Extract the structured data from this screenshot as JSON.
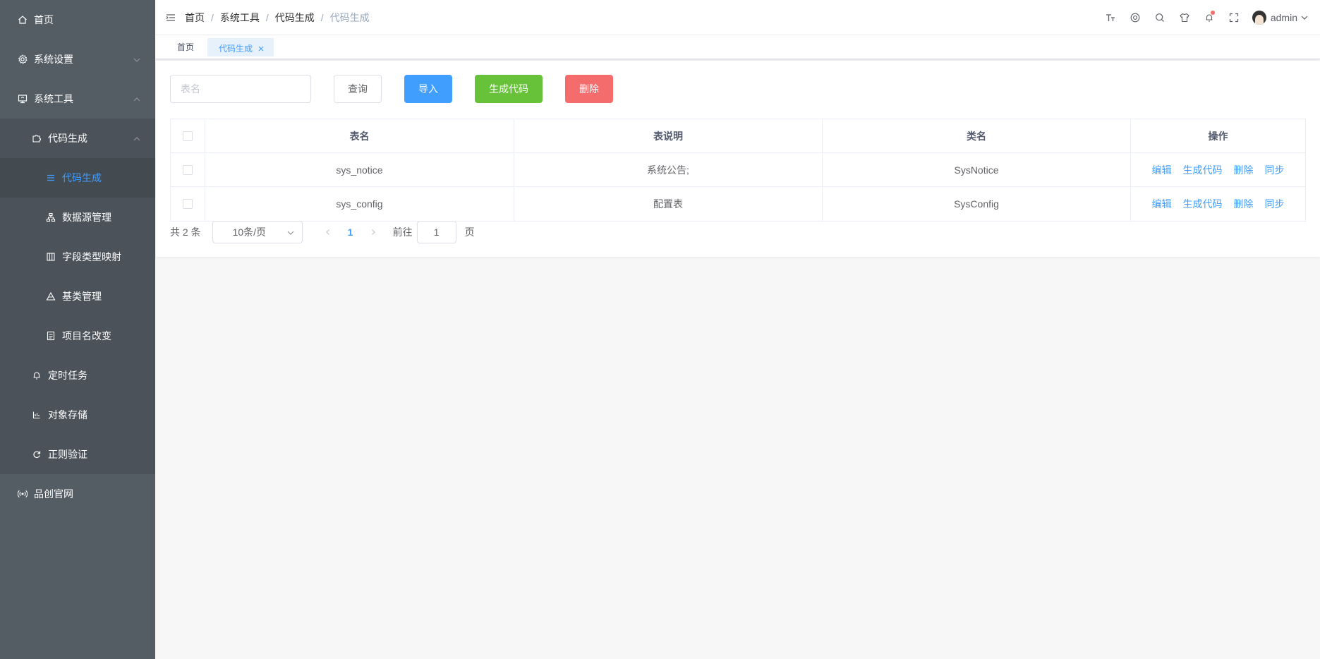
{
  "sidebar": {
    "items": [
      {
        "label": "首页",
        "icon": "home-icon"
      },
      {
        "label": "系统设置",
        "icon": "gear-icon"
      },
      {
        "label": "系统工具",
        "icon": "monitor-icon"
      },
      {
        "label": "代码生成",
        "icon": "puzzle-icon"
      },
      {
        "label": "代码生成",
        "icon": "list-icon"
      },
      {
        "label": "数据源管理",
        "icon": "sitemap-icon"
      },
      {
        "label": "字段类型映射",
        "icon": "table-icon"
      },
      {
        "label": "基类管理",
        "icon": "triangle-icon"
      },
      {
        "label": "项目名改变",
        "icon": "document-icon"
      },
      {
        "label": "定时任务",
        "icon": "bell-icon"
      },
      {
        "label": "对象存储",
        "icon": "storage-icon"
      },
      {
        "label": "正则验证",
        "icon": "refresh-icon"
      },
      {
        "label": "品创官网",
        "icon": "broadcast-icon"
      }
    ],
    "active_color": "#409eff",
    "bg_color": "#545c64"
  },
  "header": {
    "breadcrumb": [
      "首页",
      "系统工具",
      "代码生成",
      "代码生成"
    ],
    "separator": "/",
    "username": "admin",
    "icons": [
      "font-size-icon",
      "github-icon",
      "search-icon",
      "skin-icon",
      "bell-icon",
      "fullscreen-icon"
    ]
  },
  "tags": {
    "home": "首页",
    "active": "代码生成"
  },
  "toolbar": {
    "search_placeholder": "表名",
    "query_label": "查询",
    "import_label": "导入",
    "generate_label": "生成代码",
    "delete_label": "删除"
  },
  "table": {
    "columns": [
      "表名",
      "表说明",
      "类名",
      "操作"
    ],
    "rows": [
      {
        "name": "sys_notice",
        "desc": "系统公告;",
        "cls": "SysNotice"
      },
      {
        "name": "sys_config",
        "desc": "配置表",
        "cls": "SysConfig"
      }
    ],
    "ops": [
      "编辑",
      "生成代码",
      "删除",
      "同步"
    ]
  },
  "pager": {
    "total": "共 2 条",
    "page_size": "10条/页",
    "current": "1",
    "goto_label": "前往",
    "goto_value": "1",
    "page_suffix": "页"
  }
}
